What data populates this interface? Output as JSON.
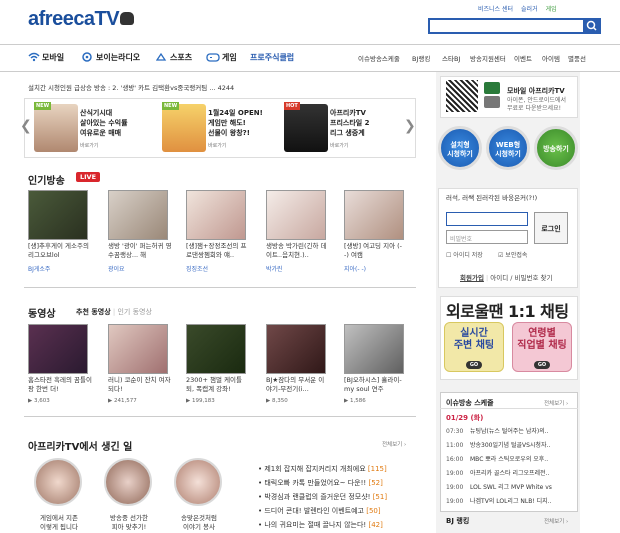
{
  "header": {
    "logo": "afreecaTV",
    "top_links": [
      "비즈니스 센터",
      "슬러거",
      "게임"
    ],
    "search_placeholder": ""
  },
  "nav": {
    "items": [
      "모바일",
      "보이는라디오",
      "스포츠",
      "게임",
      "프로주식클럽"
    ],
    "right_items": [
      "이슈방송스케줄",
      "BJ랭킹",
      "스타BJ",
      "방송지원센터",
      "이벤트",
      "아이템",
      "별풍선"
    ]
  },
  "notice": "설치간 시청인원 급상승 방송 : 2. '생방' 카트 김택환vs중국랭커팀 ... 4244",
  "banners": [
    {
      "badge": "NEW",
      "title": "산식기시대\n살아있는 수익률\n여유로운 매매",
      "sub": "바로가기"
    },
    {
      "badge": "NEW",
      "title": "1월24일 OPEN!\n게임만 해도!\n선물이 왕창?!",
      "sub": "바로가기"
    },
    {
      "badge": "HOT",
      "title": "아프리카TV\n프리스타일 2\n리그 생중계",
      "sub": "바로가기"
    }
  ],
  "live": {
    "title": "인기방송",
    "badge": "LIVE",
    "items": [
      {
        "caption": "[생]추후게이 게소주의 리그오브lol",
        "sub": "BJ게소주"
      },
      {
        "caption": "생방 '광이' 퍼는허귀 영수꿈랭상... 해",
        "sub": "광이요"
      },
      {
        "caption": "[생]잼+장정조선의 프로댄쌍쳄회와 얘..",
        "sub": "징징조선"
      },
      {
        "caption": "생방송 박가린(긴하 데이트..음치현.)..",
        "sub": "박가린"
      },
      {
        "caption": "[생방] 여고딩 지아 (- -) 여캠",
        "sub": "지아(- -)"
      }
    ]
  },
  "vod": {
    "title": "동영상",
    "tab_on": "추천 동영상",
    "tab_off": "인기 동영상",
    "items": [
      {
        "caption": "홈스타전 흑레의 꿈틀이 팡 한번 더!",
        "views": "3,603"
      },
      {
        "caption": "러니) 코순이 잔치 여자되다!",
        "views": "241,577"
      },
      {
        "caption": "2300+ 챔멀 케이틀 퇴, 폭캡계 강좌!",
        "views": "199,183"
      },
      {
        "caption": "BJ★잠다의 무서운 이야기-무전기(i...",
        "views": "8,350"
      },
      {
        "caption": "[BJ오하시스] 흘라이-my soul 연주",
        "views": "1,586"
      }
    ]
  },
  "community": {
    "title": "아프리카TV에서 생긴 일",
    "more": "전체보기",
    "circles": [
      "게임에서 지존\n이렇게 됩니다",
      "방송중 선가한\n피아 맞추기!",
      "송맞은것처럼\n이야기 봉사"
    ],
    "list": [
      {
        "text": "제1회 잡지해 잡지커리지 개최에요",
        "n": "[115]"
      },
      {
        "text": "태릭오빠 카톡 만들었어요~ 다운!!",
        "n": "[52]"
      },
      {
        "text": "박경심과 랜클럽의 즐거운던 정모샷!",
        "n": "[51]"
      },
      {
        "text": "드디어 콘대! 발렌타인 이벤트예고",
        "n": "[50]"
      },
      {
        "text": "나의 귀요미는 절때 끌나지 않는다!",
        "n": "[42]"
      }
    ]
  },
  "mobile": {
    "title": "모바일 아프리카TV",
    "desc": "아이폰, 안드로이드에서\n무료로 다운받으세요!"
  },
  "buttons": [
    "설치형\n시청하기",
    "WEB형\n시청하기",
    "방송하기"
  ],
  "login": {
    "question": "러석, 러쌕 된러각된 바웅은커(?!)",
    "id_placeholder": "",
    "pw_placeholder": "비밀번호",
    "button": "로그인",
    "save_id": "아이디 저장",
    "secure": "보안접속",
    "join": "회원가입",
    "find": "아이디 / 비밀번호 찾기"
  },
  "chat": {
    "title": "외로울땐 1:1 채팅",
    "left": "실시간\n주변 채팅",
    "right": "연령별\n직업별 채팅",
    "go": "GO"
  },
  "schedule": {
    "title": "이슈방송 스케줄",
    "more": "전체보기",
    "date": "01/29 (화)",
    "rows": [
      {
        "time": "07:30",
        "text": "뉴팅남(뉴스 털어주는 남자)의.."
      },
      {
        "time": "11:00",
        "text": "방송300일기념 털골VS시청자.."
      },
      {
        "time": "16:00",
        "text": "MBC 뽀라 스틱오로우의 오후.."
      },
      {
        "time": "19:00",
        "text": "아프리카 골스타 리그오프레전.."
      },
      {
        "time": "19:00",
        "text": "LOL SWL 리그 MVP White vs"
      },
      {
        "time": "19:00",
        "text": "나겜TV의 LOL리그 NLB! 디지.."
      }
    ]
  },
  "bjrank": {
    "title": "BJ 랭킹",
    "more": "전체보기"
  }
}
